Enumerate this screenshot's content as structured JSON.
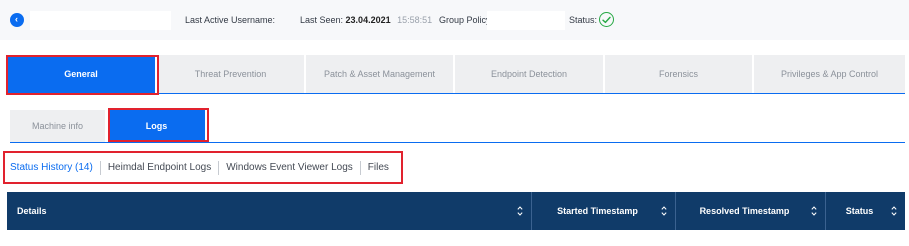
{
  "header": {
    "last_active_username_label": "Last Active Username:",
    "last_seen_label": "Last Seen:",
    "last_seen_date": "23.04.2021",
    "last_seen_time": "15:58:51",
    "group_policy_label": "Group Policy:",
    "status_label": "Status:",
    "status_icon": "check-circle-icon",
    "back_icon": "chevron-left-icon"
  },
  "main_tabs": [
    {
      "label": "General",
      "active": true
    },
    {
      "label": "Threat Prevention",
      "active": false
    },
    {
      "label": "Patch & Asset Management",
      "active": false
    },
    {
      "label": "Endpoint Detection",
      "active": false
    },
    {
      "label": "Forensics",
      "active": false
    },
    {
      "label": "Privileges & App Control",
      "active": false
    }
  ],
  "sub_tabs": [
    {
      "label": "Machine info",
      "active": false
    },
    {
      "label": "Logs",
      "active": true
    }
  ],
  "log_links": [
    {
      "label": "Status History (14)",
      "active": true
    },
    {
      "label": "Heimdal Endpoint Logs",
      "active": false
    },
    {
      "label": "Windows Event Viewer Logs",
      "active": false
    },
    {
      "label": "Files",
      "active": false
    }
  ],
  "table": {
    "columns": [
      "Details",
      "Started Timestamp",
      "Resolved Timestamp",
      "Status"
    ]
  },
  "colors": {
    "accent": "#0a6cf0",
    "table_header": "#103b69",
    "highlight": "#e1222e",
    "status_ok": "#27a844"
  }
}
